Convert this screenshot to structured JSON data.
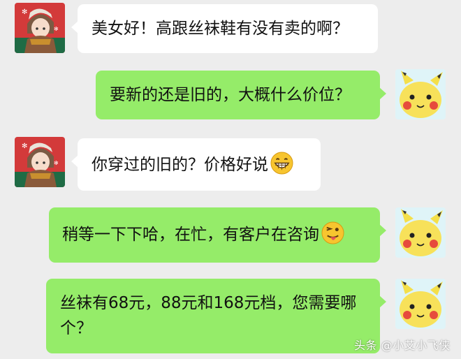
{
  "messages": [
    {
      "side": "left",
      "text": "美女好！高跟丝袜鞋有没有卖的啊？"
    },
    {
      "side": "right",
      "text": "要新的还是旧的，大概什么价位？"
    },
    {
      "side": "left",
      "text": "你穿过的旧的？价格好说",
      "emoji": "grinning-face"
    },
    {
      "side": "right",
      "text": "稍等一下下哈，在忙，有客户在咨询",
      "emoji": "winking-tongue-face"
    },
    {
      "side": "right",
      "line1": "丝袜有68元，88元和168元档，您需要哪",
      "line2": "个？"
    }
  ],
  "watermark": "头条 @小艾小飞侠",
  "colors": {
    "background": "#ededed",
    "incoming_bubble": "#ffffff",
    "outgoing_bubble": "#95ec69"
  }
}
